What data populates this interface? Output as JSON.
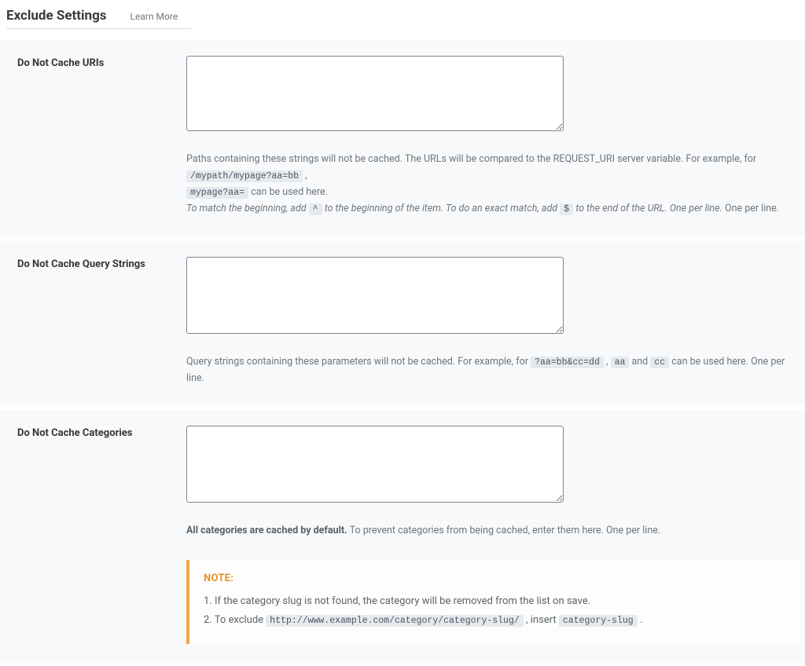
{
  "header": {
    "title": "Exclude Settings",
    "learn_more": "Learn More"
  },
  "sections": {
    "uris": {
      "label": "Do Not Cache URIs",
      "value": "",
      "help1a": "Paths containing these strings will not be cached. The URLs will be compared to the REQUEST_URI server variable. For example, for ",
      "code1": "/mypath/mypage?aa=bb",
      "help1b": " , ",
      "code2": "mypage?aa=",
      "help1c": " can be used here.",
      "help2a": "To match the beginning, add ",
      "code3": "^",
      "help2b": " to the beginning of the item. To do an exact match, add ",
      "code4": "$",
      "help2c": " to the end of the URL. One per line.",
      "help2d": " One per line."
    },
    "query": {
      "label": "Do Not Cache Query Strings",
      "value": "",
      "help_a": "Query strings containing these parameters will not be cached. For example, for ",
      "code1": "?aa=bb&cc=dd",
      "help_b": " , ",
      "code2": "aa",
      "help_c": " and ",
      "code3": "cc",
      "help_d": " can be used here. One per line."
    },
    "categories": {
      "label": "Do Not Cache Categories",
      "value": "",
      "help_bold": "All categories are cached by default.",
      "help_rest": " To prevent categories from being cached, enter them here. One per line.",
      "note_title": "NOTE:",
      "note1": "If the category slug is not found, the category will be removed from the list on save.",
      "note2a": "To exclude ",
      "note2_code1": "http://www.example.com/category/category-slug/",
      "note2b": " , insert ",
      "note2_code2": "category-slug",
      "note2c": " ."
    }
  }
}
